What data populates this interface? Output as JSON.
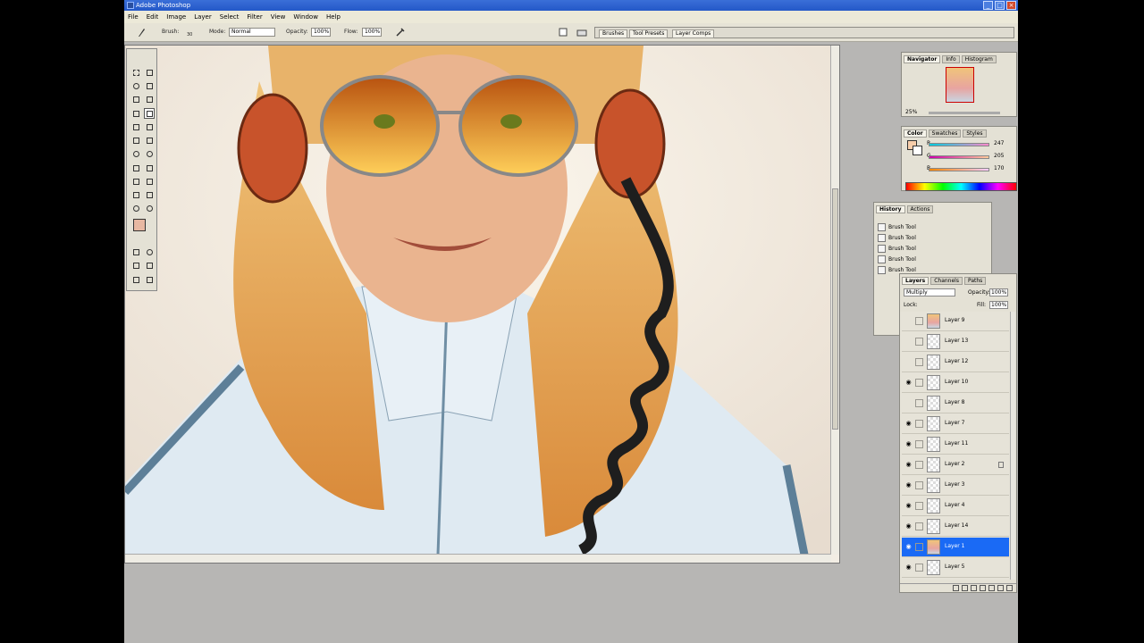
{
  "window": {
    "title": "Adobe Photoshop"
  },
  "menu": [
    "File",
    "Edit",
    "Image",
    "Layer",
    "Select",
    "Filter",
    "View",
    "Window",
    "Help"
  ],
  "options": {
    "brush_label": "Brush:",
    "brush_size": "30",
    "mode_label": "Mode:",
    "mode_value": "Normal",
    "opacity_label": "Opacity:",
    "opacity_value": "100%",
    "flow_label": "Flow:",
    "flow_value": "100%"
  },
  "palette_well": [
    "Brushes",
    "Tool Presets",
    "Layer Comps"
  ],
  "navigator": {
    "tabs": [
      "Navigator",
      "Info",
      "Histogram"
    ],
    "zoom": "25%"
  },
  "color_panel": {
    "tabs": [
      "Color",
      "Swatches",
      "Styles"
    ],
    "channels": [
      {
        "label": "R",
        "value": "247"
      },
      {
        "label": "G",
        "value": "205"
      },
      {
        "label": "B",
        "value": "170"
      }
    ],
    "foreground": "#f7cdaa"
  },
  "history": {
    "tabs": [
      "History",
      "Actions"
    ],
    "items": [
      "Brush Tool",
      "Brush Tool",
      "Brush Tool",
      "Brush Tool",
      "Brush Tool"
    ]
  },
  "layers": {
    "tabs": [
      "Layers",
      "Channels",
      "Paths"
    ],
    "blend_mode": "Multiply",
    "opacity_label": "Opacity:",
    "opacity_value": "100%",
    "lock_label": "Lock:",
    "fill_label": "Fill:",
    "fill_value": "100%",
    "items": [
      {
        "name": "Layer 9",
        "visible": false,
        "locked": false,
        "selected": false,
        "portrait": true
      },
      {
        "name": "Layer 13",
        "visible": false,
        "locked": false,
        "selected": false,
        "portrait": false
      },
      {
        "name": "Layer 12",
        "visible": false,
        "locked": false,
        "selected": false,
        "portrait": false
      },
      {
        "name": "Layer 10",
        "visible": true,
        "locked": false,
        "selected": false,
        "portrait": false
      },
      {
        "name": "Layer 8",
        "visible": false,
        "locked": false,
        "selected": false,
        "portrait": false
      },
      {
        "name": "Layer 7",
        "visible": true,
        "locked": false,
        "selected": false,
        "portrait": false
      },
      {
        "name": "Layer 11",
        "visible": true,
        "locked": false,
        "selected": false,
        "portrait": false
      },
      {
        "name": "Layer 2",
        "visible": true,
        "locked": true,
        "selected": false,
        "portrait": false
      },
      {
        "name": "Layer 3",
        "visible": true,
        "locked": false,
        "selected": false,
        "portrait": false
      },
      {
        "name": "Layer 4",
        "visible": true,
        "locked": false,
        "selected": false,
        "portrait": false
      },
      {
        "name": "Layer 14",
        "visible": true,
        "locked": false,
        "selected": false,
        "portrait": false
      },
      {
        "name": "Layer 1",
        "visible": true,
        "locked": false,
        "selected": true,
        "portrait": true
      },
      {
        "name": "Layer 5",
        "visible": true,
        "locked": false,
        "selected": false,
        "portrait": false
      }
    ]
  },
  "colors": {
    "selection": "#1a6af5",
    "titlebar": "#2a5fcf",
    "canvas_bg": "#f2ede4"
  }
}
